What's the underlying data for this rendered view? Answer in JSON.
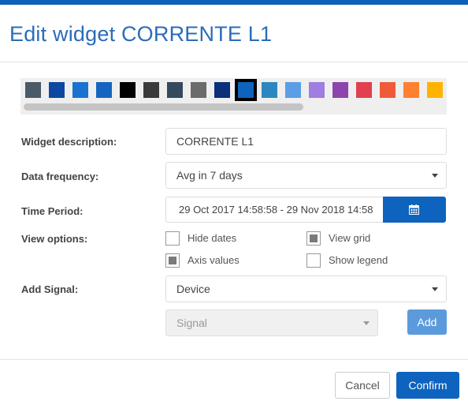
{
  "title": "Edit widget CORRENTE L1",
  "palette": {
    "colors": [
      "#4a5a67",
      "#0d47a1",
      "#1a73d1",
      "#1565c0",
      "#000000",
      "#3a3a3a",
      "#34495e",
      "#6b6b6b",
      "#0b2f7a",
      "#0d63be",
      "#2e86c1",
      "#5b9ee6",
      "#a07de0",
      "#8e44ad",
      "#e04050",
      "#ef5b3a",
      "#ff8030",
      "#ffb300"
    ],
    "selected_index": 9
  },
  "form": {
    "description_label": "Widget description:",
    "description_value": "CORRENTE L1",
    "frequency_label": "Data frequency:",
    "frequency_value": "Avg in 7 days",
    "period_label": "Time Period:",
    "period_value": "29 Oct 2017 14:58:58 - 29 Nov 2018 14:58",
    "view_label": "View options:",
    "options": {
      "hide_dates": {
        "label": "Hide dates",
        "checked": false
      },
      "view_grid": {
        "label": "View grid",
        "checked": true
      },
      "axis_values": {
        "label": "Axis values",
        "checked": true
      },
      "show_legend": {
        "label": "Show legend",
        "checked": false
      }
    },
    "signal_label": "Add Signal:",
    "device_value": "Device",
    "signal_placeholder": "Signal",
    "add_label": "Add"
  },
  "footer": {
    "cancel_label": "Cancel",
    "confirm_label": "Confirm"
  },
  "colors": {
    "accent": "#0d63be",
    "title": "#2b6cb8"
  },
  "icons": {
    "calendar": "calendar-icon"
  }
}
